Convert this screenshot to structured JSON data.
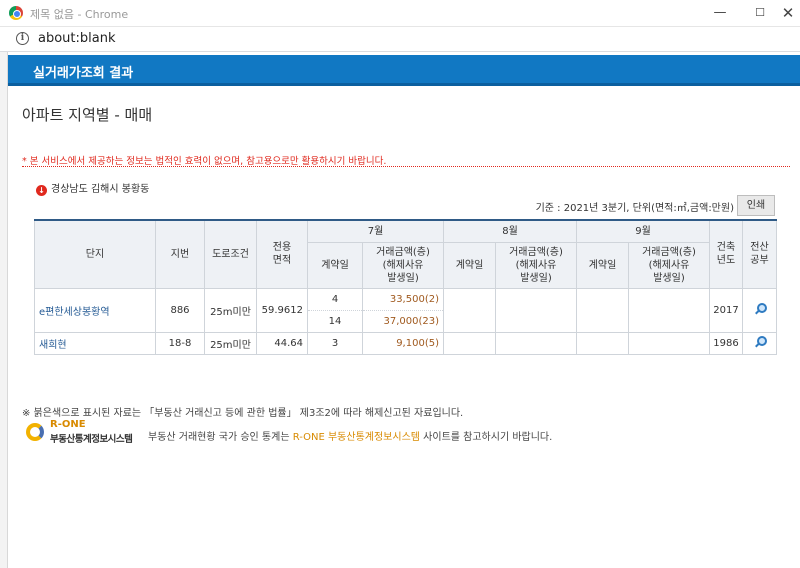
{
  "window": {
    "title": "제목 없음 - Chrome",
    "min": "—",
    "max": "☐",
    "close": "✕"
  },
  "address": {
    "url": "about:blank"
  },
  "header": {
    "title": "실거래가조회 결과"
  },
  "page": {
    "title": "아파트 지역별 - 매매",
    "notice": "* 본 서비스에서 제공하는 정보는 법적인 효력이 없으며, 참고용으로만 활용하시기 바랍니다.",
    "location": "경상남도 김해시 봉황동",
    "criteria": "기준 : 2021년 3분기, 단위(면적:㎡,금액:만원)",
    "print_label": "인쇄"
  },
  "table": {
    "headers": {
      "complex": "단지",
      "lot": "지번",
      "road": "도로조건",
      "area": "전용\n면적",
      "build_year": "건축\n년도",
      "public": "전산\n공부",
      "months": [
        "7월",
        "8월",
        "9월"
      ],
      "contract_day": "계약일",
      "amount": "거래금액(층)\n(해제사유\n발생일)"
    },
    "rows": [
      {
        "name": "e편한세상봉황역",
        "lot": "886",
        "road": "25m미만",
        "area": "59.9612",
        "deals": [
          {
            "day": "4",
            "amount": "33,500",
            "floor": "(2)"
          },
          {
            "day": "14",
            "amount": "37,000",
            "floor": "(23)"
          }
        ],
        "build_year": "2017"
      },
      {
        "name": "새희현",
        "lot": "18-8",
        "road": "25m미만",
        "area": "44.64",
        "deals": [
          {
            "day": "3",
            "amount": "9,100",
            "floor": "(5)"
          }
        ],
        "build_year": "1986"
      }
    ]
  },
  "footer": {
    "footnote": "※ 붉은색으로 표시된 자료는 「부동산 거래신고 등에 관한 법률」 제3조2에 따라 해제신고된 자료입니다.",
    "logo_top": "R-ONE",
    "logo_bottom": "부동산통계정보시스템",
    "rone_pre": "부동산 거래현황 국가 승인 통계는 ",
    "rone_highlight": "R-ONE 부동산통계정보시스템",
    "rone_post": " 사이트를 참고하시기 바랍니다."
  }
}
